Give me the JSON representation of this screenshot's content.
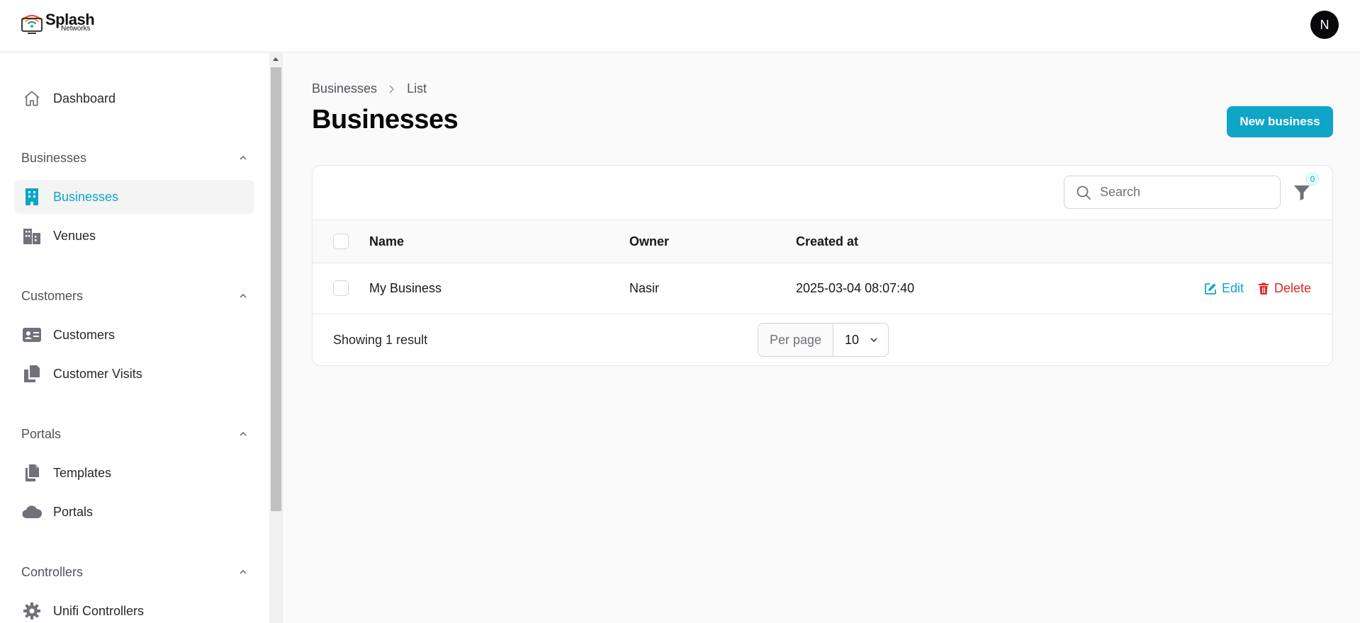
{
  "brand": {
    "name": "Splash",
    "sub": "Networks"
  },
  "user": {
    "initial": "N"
  },
  "sidebar": {
    "dashboard": "Dashboard",
    "groups": [
      {
        "label": "Businesses",
        "items": [
          "Businesses",
          "Venues"
        ]
      },
      {
        "label": "Customers",
        "items": [
          "Customers",
          "Customer Visits"
        ]
      },
      {
        "label": "Portals",
        "items": [
          "Templates",
          "Portals"
        ]
      },
      {
        "label": "Controllers",
        "items": [
          "Unifi Controllers"
        ]
      }
    ]
  },
  "breadcrumb": {
    "parent": "Businesses",
    "current": "List"
  },
  "page": {
    "title": "Businesses",
    "new_button": "New business"
  },
  "table": {
    "search_placeholder": "Search",
    "filter_count": "0",
    "columns": [
      "Name",
      "Owner",
      "Created at"
    ],
    "rows": [
      {
        "name": "My Business",
        "owner": "Nasir",
        "created_at": "2025-03-04 08:07:40"
      }
    ],
    "actions": {
      "edit": "Edit",
      "delete": "Delete"
    },
    "summary": "Showing 1 result",
    "per_page_label": "Per page",
    "per_page_value": "10"
  },
  "colors": {
    "accent": "#0ea5c6",
    "danger": "#dc2626",
    "avatar": "#09090b"
  }
}
